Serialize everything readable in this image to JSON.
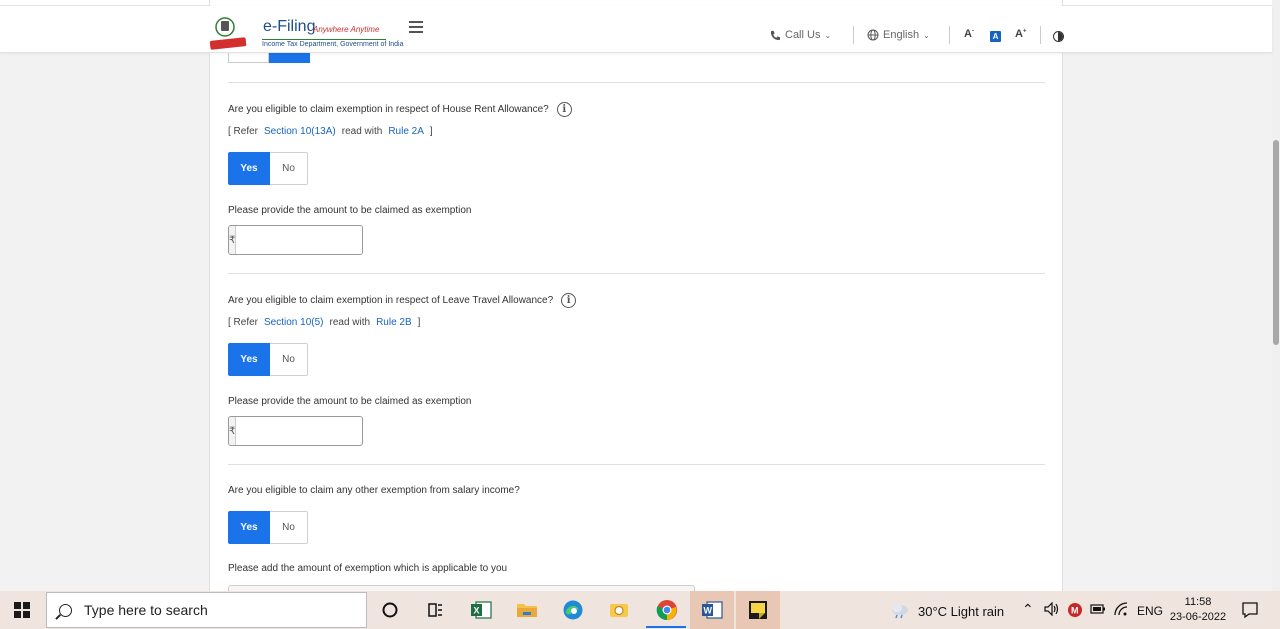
{
  "header": {
    "logo_title": "e-Filing",
    "logo_tagline": "Anywhere Anytime",
    "logo_department": "Income Tax Department, Government of India",
    "call_us": "Call Us",
    "language": "English",
    "font_decrease": "A",
    "font_default": "A",
    "font_increase": "A"
  },
  "sections": [
    {
      "question": "Are you eligible to claim exemption in respect of House Rent Allowance?",
      "ref_open": "[ Refer",
      "section_link": "Section 10(13A)",
      "read_with": "read with",
      "rule_link": "Rule 2A",
      "ref_close": "]",
      "yes": "Yes",
      "no": "No",
      "amount_label": "Please provide the amount to be claimed as exemption",
      "currency": "₹",
      "amount_value": ""
    },
    {
      "question": "Are you eligible to claim exemption in respect of Leave Travel Allowance?",
      "ref_open": "[ Refer",
      "section_link": "Section 10(5)",
      "read_with": "read with",
      "rule_link": "Rule 2B",
      "ref_close": "]",
      "yes": "Yes",
      "no": "No",
      "amount_label": "Please provide the amount to be claimed as exemption",
      "currency": "₹",
      "amount_value": ""
    },
    {
      "question": "Are you eligible to claim any other exemption from salary income?",
      "yes": "Yes",
      "no": "No",
      "amount_label": "Please add the amount of exemption which is applicable to you"
    }
  ],
  "taskbar": {
    "search_placeholder": "Type here to search",
    "weather": "30°C  Light rain",
    "language": "ENG",
    "time": "11:58",
    "date": "23-06-2022"
  },
  "colors": {
    "accent": "#1a73e8",
    "link": "#1565c0"
  }
}
